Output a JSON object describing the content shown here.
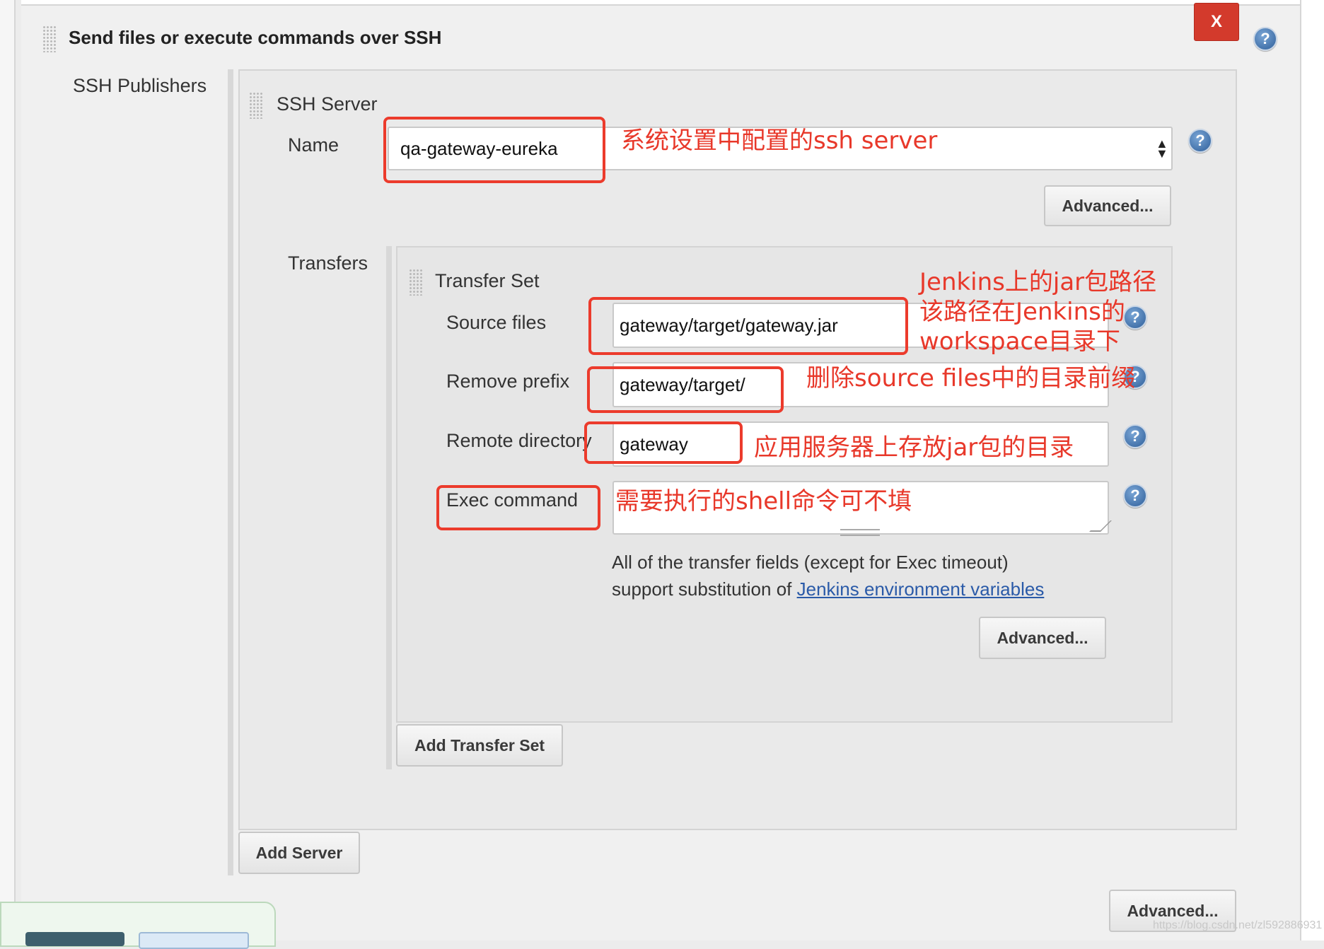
{
  "section": {
    "title": "Send files or execute commands over SSH",
    "close_label": "X",
    "help": "?"
  },
  "publishers_label": "SSH Publishers",
  "ssh_server": {
    "title": "SSH Server",
    "name_label": "Name",
    "name_value": "qa-gateway-eureka",
    "advanced_label": "Advanced..."
  },
  "transfers": {
    "label": "Transfers",
    "set_title": "Transfer Set",
    "source_files_label": "Source files",
    "source_files_value": "gateway/target/gateway.jar",
    "remove_prefix_label": "Remove prefix",
    "remove_prefix_value": "gateway/target/",
    "remote_directory_label": "Remote directory",
    "remote_directory_value": "gateway",
    "exec_command_label": "Exec command",
    "hint_line1": "All of the transfer fields (except for Exec timeout)",
    "hint_line2_prefix": "support substitution of ",
    "hint_link": "Jenkins environment variables",
    "advanced_label": "Advanced...",
    "add_set_label": "Add Transfer Set"
  },
  "add_server_label": "Add Server",
  "outer_advanced_label": "Advanced...",
  "annotations": {
    "server": "系统设置中配置的ssh server",
    "source_line1": "Jenkins上的jar包路径",
    "source_line2": "该路径在Jenkins的",
    "source_line3": "workspace目录下",
    "prefix": "删除source files中的目录前缀",
    "remote": "应用服务器上存放jar包的目录",
    "exec": "需要执行的shell命令可不填"
  },
  "watermark": "https://blog.csdn.net/zl592886931",
  "colors": {
    "annotation": "#e8382a",
    "link": "#2a5aa8",
    "close": "#d33a2c"
  }
}
